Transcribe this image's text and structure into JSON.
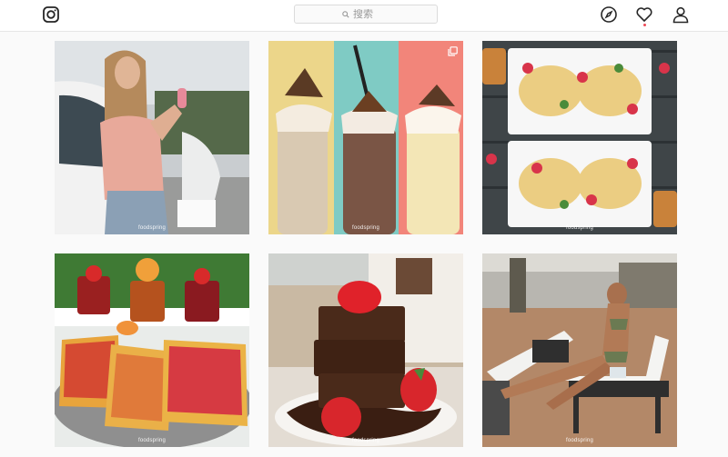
{
  "header": {
    "logo_icon": "instagram-icon",
    "search": {
      "icon": "search-icon",
      "placeholder": "搜索"
    },
    "nav": [
      {
        "name": "explore-compass-icon"
      },
      {
        "name": "activity-heart-icon",
        "notification": true
      },
      {
        "name": "profile-person-icon"
      }
    ]
  },
  "colors": {
    "notification_dot": "#ed4956",
    "border": "#dbdbdb",
    "page_bg": "#fafafa"
  },
  "posts": [
    {
      "subject": "woman holding popsicle by white car",
      "watermark": "foodspring",
      "multi_image": false
    },
    {
      "subject": "three protein shakes on colored backgrounds",
      "watermark": "foodspring",
      "multi_image": true
    },
    {
      "subject": "fruit pancake trays on dark wood",
      "watermark": "foodspring",
      "multi_image": false
    },
    {
      "subject": "waffles with fruit jam and jars",
      "watermark": "foodspring",
      "multi_image": false
    },
    {
      "subject": "chocolate brownie stack with strawberries",
      "watermark": "foodspring",
      "multi_image": false
    },
    {
      "subject": "woman in bikini on sun lounger",
      "watermark": "foodspring",
      "multi_image": false
    }
  ]
}
